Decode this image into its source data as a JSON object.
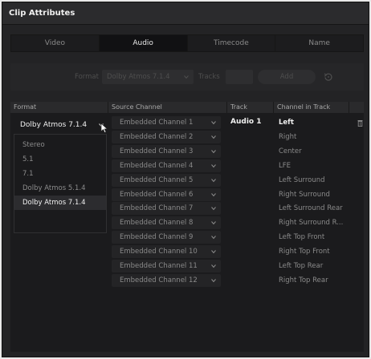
{
  "window": {
    "title": "Clip Attributes"
  },
  "tabs": [
    {
      "label": "Video",
      "active": false
    },
    {
      "label": "Audio",
      "active": true
    },
    {
      "label": "Timecode",
      "active": false
    },
    {
      "label": "Name",
      "active": false
    }
  ],
  "format_bar": {
    "format_label": "Format",
    "format_value": "Dolby Atmos 7.1.4",
    "tracks_label": "Tracks",
    "add_label": "Add",
    "reset_icon": "reset-icon"
  },
  "grid": {
    "headers": {
      "format": "Format",
      "source_channel": "Source Channel",
      "track": "Track",
      "channel_in_track": "Channel in Track"
    },
    "format_value": "Dolby Atmos 7.1.4",
    "format_options": [
      "Stereo",
      "5.1",
      "7.1",
      "Dolby Atmos 5.1.4",
      "Dolby Atmos 7.1.4"
    ],
    "selected_option": "Dolby Atmos 7.1.4",
    "track_value": "Audio 1",
    "rows": [
      {
        "source": "Embedded Channel 1",
        "channel": "Left"
      },
      {
        "source": "Embedded Channel 2",
        "channel": "Right"
      },
      {
        "source": "Embedded Channel 3",
        "channel": "Center"
      },
      {
        "source": "Embedded Channel 4",
        "channel": "LFE"
      },
      {
        "source": "Embedded Channel 5",
        "channel": "Left Surround"
      },
      {
        "source": "Embedded Channel 6",
        "channel": "Right Surround"
      },
      {
        "source": "Embedded Channel 7",
        "channel": "Left Surround Rear"
      },
      {
        "source": "Embedded Channel 8",
        "channel": "Right Surround R..."
      },
      {
        "source": "Embedded Channel 9",
        "channel": "Left Top Front"
      },
      {
        "source": "Embedded Channel 10",
        "channel": "Right Top Front"
      },
      {
        "source": "Embedded Channel 11",
        "channel": "Left Top Rear"
      },
      {
        "source": "Embedded Channel 12",
        "channel": "Right Top Rear"
      }
    ]
  },
  "colors": {
    "background": "#232325",
    "panel": "#1b1b1d",
    "text_primary": "#f0f0f0",
    "text_secondary": "#8a8a8a",
    "text_disabled": "#4e4e4e"
  }
}
